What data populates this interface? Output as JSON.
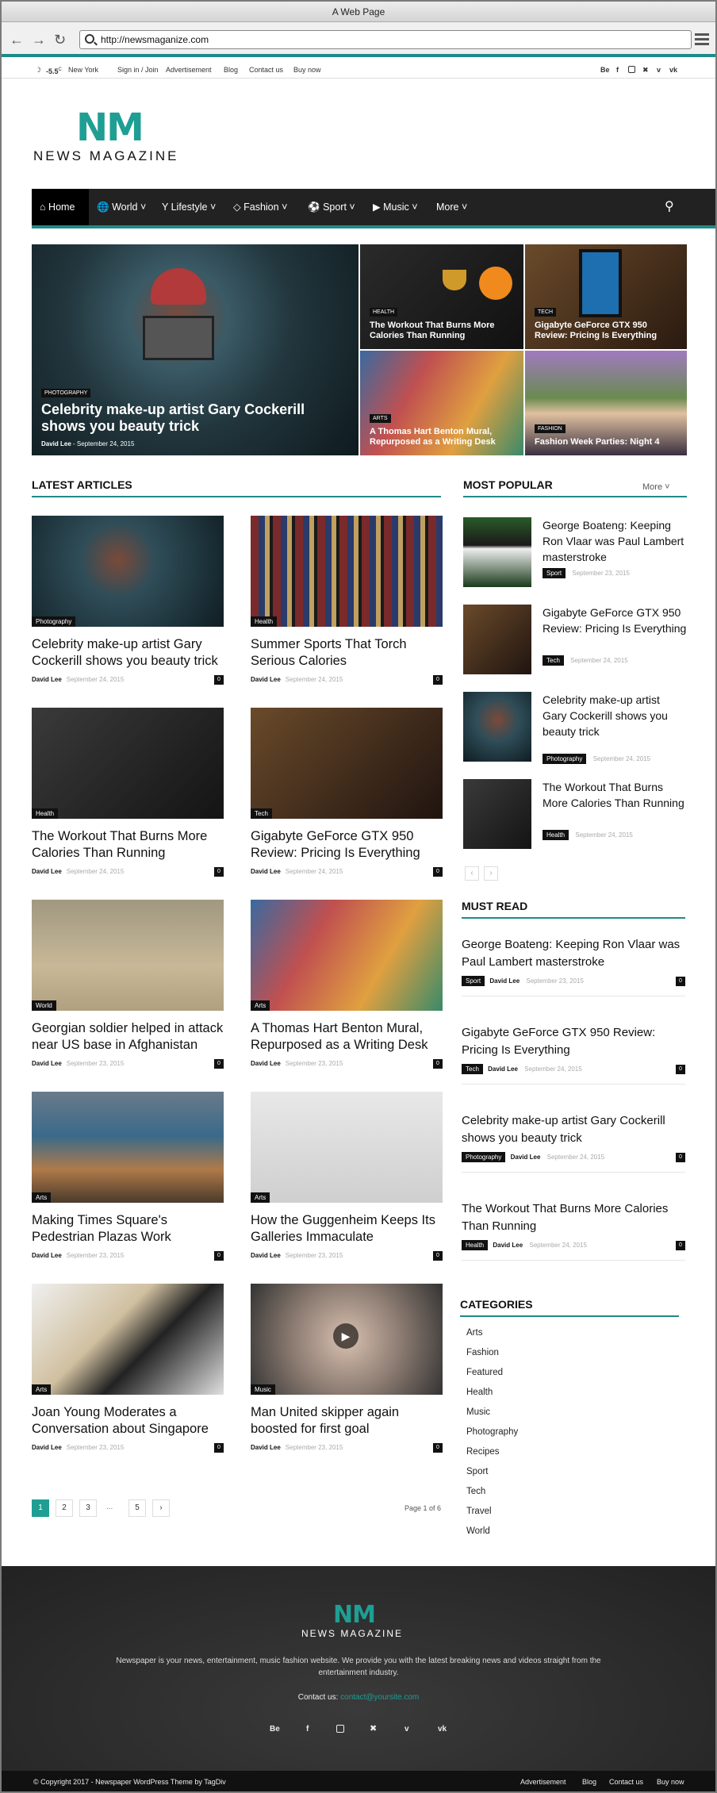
{
  "browser": {
    "title": "A Web Page",
    "url": "http://newsmaganize.com"
  },
  "topbar": {
    "temp": "-5.5",
    "unit": "C",
    "city": "New York",
    "links": [
      "Sign in / Join",
      "Advertisement",
      "Blog",
      "Contact us",
      "Buy now"
    ],
    "social": [
      "Be",
      "f",
      "ig",
      "tw",
      "v",
      "vk"
    ]
  },
  "logo": {
    "mark": "NM",
    "text": "NEWS MAGAZINE"
  },
  "nav": {
    "items": [
      "Home",
      "World",
      "Lifestyle",
      "Fashion",
      "Sport",
      "Music",
      "More"
    ]
  },
  "hero": [
    {
      "tag": "PHOTOGRAPHY",
      "title": "Celebrity make-up artist Gary Cockerill shows you beauty trick",
      "author": "David Lee",
      "date": "September 24, 2015"
    },
    {
      "tag": "HEALTH",
      "title": "The Workout That Burns More Calories Than Running"
    },
    {
      "tag": "TECH",
      "title": "Gigabyte GeForce GTX 950 Review: Pricing Is Everything"
    },
    {
      "tag": "ARTS",
      "title": "A Thomas Hart Benton Mural, Repurposed as a Writing Desk"
    },
    {
      "tag": "FASHION",
      "title": "Fashion Week Parties: Night 4"
    }
  ],
  "latest": {
    "heading": "LATEST ARTICLES",
    "articles": [
      {
        "tag": "Photography",
        "title": "Celebrity make-up artist Gary Cockerill shows you beauty trick",
        "author": "David Lee",
        "date": "September 24, 2015",
        "count": "0"
      },
      {
        "tag": "Health",
        "title": "Summer Sports That Torch Serious Calories",
        "author": "David Lee",
        "date": "September 24, 2015",
        "count": "0"
      },
      {
        "tag": "Health",
        "title": "The Workout That Burns More Calories Than Running",
        "author": "David Lee",
        "date": "September 24, 2015",
        "count": "0"
      },
      {
        "tag": "Tech",
        "title": "Gigabyte GeForce GTX 950 Review: Pricing Is Everything",
        "author": "David Lee",
        "date": "September 24, 2015",
        "count": "0"
      },
      {
        "tag": "World",
        "title": "Georgian soldier helped in attack near US base in Afghanistan",
        "author": "David Lee",
        "date": "September 23, 2015",
        "count": "0"
      },
      {
        "tag": "Arts",
        "title": "A Thomas Hart Benton Mural, Repurposed as a Writing Desk",
        "author": "David Lee",
        "date": "September 23, 2015",
        "count": "0"
      },
      {
        "tag": "Arts",
        "title": "Making Times Square's Pedestrian Plazas Work",
        "author": "David Lee",
        "date": "September 23, 2015",
        "count": "0"
      },
      {
        "tag": "Arts",
        "title": "How the Guggenheim Keeps Its Galleries Immaculate",
        "author": "David Lee",
        "date": "September 23, 2015",
        "count": "0"
      },
      {
        "tag": "Arts",
        "title": "Joan Young Moderates a Conversation about Singapore",
        "author": "David Lee",
        "date": "September 23, 2015",
        "count": "0"
      },
      {
        "tag": "Music",
        "title": "Man United skipper again boosted for first goal",
        "author": "David Lee",
        "date": "September 23, 2015",
        "count": "0"
      }
    ]
  },
  "pagination": {
    "pages": [
      "1",
      "2",
      "3",
      "...",
      "5",
      "›"
    ],
    "status": "Page 1 of 6"
  },
  "popular": {
    "heading": "MOST POPULAR",
    "more": "More",
    "items": [
      {
        "title": "George Boateng: Keeping Ron Vlaar was Paul Lambert masterstroke",
        "tag": "Sport",
        "date": "September 23, 2015"
      },
      {
        "title": "Gigabyte GeForce GTX 950 Review: Pricing Is Everything",
        "tag": "Tech",
        "date": "September 24, 2015"
      },
      {
        "title": "Celebrity make-up artist Gary Cockerill shows you beauty trick",
        "tag": "Photography",
        "date": "September 24, 2015"
      },
      {
        "title": "The Workout That Burns More Calories Than Running",
        "tag": "Health",
        "date": "September 24, 2015"
      }
    ]
  },
  "mustread": {
    "heading": "MUST READ",
    "items": [
      {
        "title": "George Boateng: Keeping Ron Vlaar was Paul Lambert masterstroke",
        "tag": "Sport",
        "author": "David Lee",
        "date": "September 23, 2015",
        "count": "0"
      },
      {
        "title": "Gigabyte GeForce GTX 950 Review: Pricing Is Everything",
        "tag": "Tech",
        "author": "David Lee",
        "date": "September 24, 2015",
        "count": "0"
      },
      {
        "title": "Celebrity make-up artist Gary Cockerill shows you beauty trick",
        "tag": "Photography",
        "author": "David Lee",
        "date": "September 24, 2015",
        "count": "0"
      },
      {
        "title": "The Workout That Burns More Calories Than Running",
        "tag": "Health",
        "author": "David Lee",
        "date": "September 24, 2015",
        "count": "0"
      }
    ]
  },
  "categories": {
    "heading": "CATEGORIES",
    "items": [
      "Arts",
      "Fashion",
      "Featured",
      "Health",
      "Music",
      "Photography",
      "Recipes",
      "Sport",
      "Tech",
      "Travel",
      "World"
    ]
  },
  "footer": {
    "mark": "NM",
    "name": "NEWS MAGAZINE",
    "about": "Newspaper is your news, entertainment, music fashion website. We provide you with the latest breaking news and videos straight from the entertainment industry.",
    "contact_label": "Contact us:",
    "contact_email": "contact@yoursite.com",
    "copyright": "© Copyright 2017 - Newspaper WordPress Theme by TagDiv",
    "links": [
      "Advertisement",
      "Blog",
      "Contact us",
      "Buy now"
    ]
  }
}
